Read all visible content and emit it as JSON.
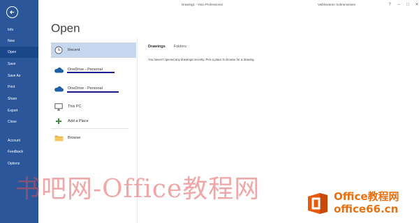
{
  "window": {
    "doc_title": "Drawing1 - Visio Professional",
    "user_name": "Vaibhavaran Subramaniam",
    "controls": [
      "?",
      "–",
      "□",
      "✕"
    ]
  },
  "nav": {
    "items": [
      {
        "label": "Info",
        "active": false
      },
      {
        "label": "New",
        "active": false
      },
      {
        "label": "Open",
        "active": true
      },
      {
        "label": "Save",
        "active": false
      },
      {
        "label": "Save As",
        "active": false
      },
      {
        "label": "Print",
        "active": false
      },
      {
        "label": "Share",
        "active": false
      },
      {
        "label": "Export",
        "active": false
      },
      {
        "label": "Close",
        "active": false
      },
      {
        "label": "Account",
        "active": false
      },
      {
        "label": "Feedback",
        "active": false
      },
      {
        "label": "Options",
        "active": false
      }
    ],
    "colors": {
      "bg": "#2b579a",
      "active": "#19478a"
    }
  },
  "main": {
    "title": "Open",
    "locations": [
      {
        "label": "Recent",
        "icon": "clock-icon",
        "selected": true
      },
      {
        "label": "OneDrive - Personal",
        "icon": "cloud-icon",
        "selected": false
      },
      {
        "label": "OneDrive - Personal",
        "icon": "cloud-icon",
        "selected": false
      },
      {
        "label": "This PC",
        "icon": "monitor-icon",
        "selected": false
      },
      {
        "label": "Add a Place",
        "icon": "plus-icon",
        "selected": false
      },
      {
        "label": "Browse",
        "icon": "folder-icon",
        "selected": false
      }
    ],
    "tabs": [
      {
        "label": "Drawings",
        "active": true
      },
      {
        "label": "Folders",
        "active": false
      }
    ],
    "empty_message": "You haven't opened any drawings recently. Pick a place to browse for a drawing."
  },
  "watermark": {
    "chinese_text": "书吧网-Office教程网",
    "brand": "Office教程网",
    "domain": "office66.cn",
    "brand_color": "#e8700f"
  }
}
